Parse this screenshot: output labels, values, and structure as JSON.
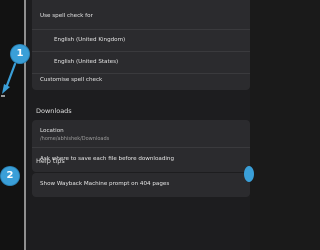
{
  "spellcheck": {
    "use_spell_check_label": "Use spell check for",
    "languages": [
      "English (United Kingdom)",
      "English (United States)"
    ],
    "customise_label": "Customise spell check"
  },
  "downloads": {
    "heading": "Downloads",
    "location_label": "Location",
    "location_path": "/home/abhishek/Downloads",
    "ask_label": "Ask where to save each file before downloading"
  },
  "help_tips": {
    "heading": "Help tips",
    "wayback_label": "Show Wayback Machine prompt on 404 pages"
  },
  "annotations": {
    "badge_1": "1",
    "badge_2": "2",
    "color": "#3a9fd8"
  }
}
